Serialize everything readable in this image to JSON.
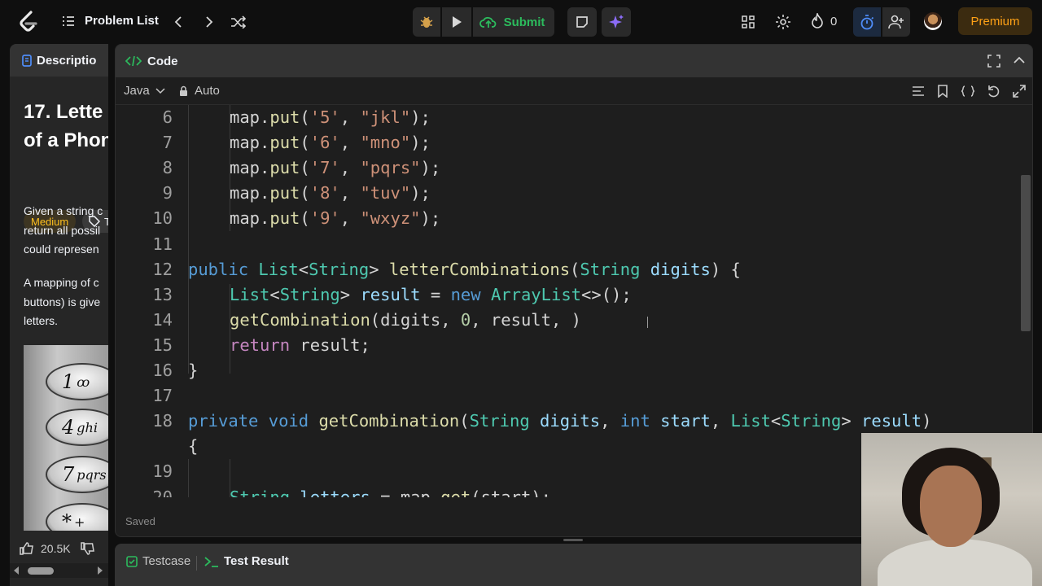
{
  "nav": {
    "problem_list_label": "Problem List",
    "submit_label": "Submit",
    "fire_count": "0",
    "premium_label": "Premium"
  },
  "left": {
    "description_tab": "Descriptio",
    "title_line1": "17. Lette",
    "title_line2": "of a Phon",
    "difficulty": "Medium",
    "topics_label": "T",
    "para1": [
      "Given a string c",
      "return all possil",
      "could represen"
    ],
    "para2": [
      "A mapping of c",
      "buttons) is give",
      "letters."
    ],
    "phone_keys": [
      {
        "digit": "1",
        "letters": "ꝏ"
      },
      {
        "digit": "4",
        "letters": "ghi"
      },
      {
        "digit": "7",
        "letters": "pqrs"
      },
      {
        "digit": "*",
        "letters": "+"
      }
    ],
    "likes": "20.5K"
  },
  "code_panel": {
    "tab_label": "Code",
    "language": "Java",
    "mode": "Auto",
    "status": "Saved"
  },
  "code_lines": [
    {
      "num": "6",
      "segs": [
        [
          "pl",
          "map."
        ],
        [
          "fn",
          "put"
        ],
        [
          "pl",
          "("
        ],
        [
          "st",
          "'5'"
        ],
        [
          "pl",
          ", "
        ],
        [
          "st",
          "\"jkl\""
        ],
        [
          "pl",
          ");"
        ]
      ]
    },
    {
      "num": "7",
      "segs": [
        [
          "pl",
          "map."
        ],
        [
          "fn",
          "put"
        ],
        [
          "pl",
          "("
        ],
        [
          "st",
          "'6'"
        ],
        [
          "pl",
          ", "
        ],
        [
          "st",
          "\"mno\""
        ],
        [
          "pl",
          ");"
        ]
      ]
    },
    {
      "num": "8",
      "segs": [
        [
          "pl",
          "map."
        ],
        [
          "fn",
          "put"
        ],
        [
          "pl",
          "("
        ],
        [
          "st",
          "'7'"
        ],
        [
          "pl",
          ", "
        ],
        [
          "st",
          "\"pqrs\""
        ],
        [
          "pl",
          ");"
        ]
      ]
    },
    {
      "num": "9",
      "segs": [
        [
          "pl",
          "map."
        ],
        [
          "fn",
          "put"
        ],
        [
          "pl",
          "("
        ],
        [
          "st",
          "'8'"
        ],
        [
          "pl",
          ", "
        ],
        [
          "st",
          "\"tuv\""
        ],
        [
          "pl",
          ");"
        ]
      ]
    },
    {
      "num": "10",
      "segs": [
        [
          "pl",
          "map."
        ],
        [
          "fn",
          "put"
        ],
        [
          "pl",
          "("
        ],
        [
          "st",
          "'9'"
        ],
        [
          "pl",
          ", "
        ],
        [
          "st",
          "\"wxyz\""
        ],
        [
          "pl",
          ");"
        ]
      ]
    },
    {
      "num": "11",
      "segs": []
    },
    {
      "num": "12",
      "segs": [
        [
          "kw",
          "public "
        ],
        [
          "ty",
          "List"
        ],
        [
          "pl",
          "<"
        ],
        [
          "ty",
          "String"
        ],
        [
          "pl",
          "> "
        ],
        [
          "fn",
          "letterCombinations"
        ],
        [
          "pl",
          "("
        ],
        [
          "ty",
          "String "
        ],
        [
          "va",
          "digits"
        ],
        [
          "pl",
          ") {"
        ]
      ]
    },
    {
      "num": "13",
      "segs": [
        [
          "ty",
          "List"
        ],
        [
          "pl",
          "<"
        ],
        [
          "ty",
          "String"
        ],
        [
          "pl",
          "> "
        ],
        [
          "va",
          "result"
        ],
        [
          "pl",
          " = "
        ],
        [
          "kw",
          "new "
        ],
        [
          "ty",
          "ArrayList"
        ],
        [
          "pl",
          "<>();"
        ]
      ]
    },
    {
      "num": "14",
      "segs": [
        [
          "fn",
          "getCombination"
        ],
        [
          "pl",
          "(digits, "
        ],
        [
          "nu",
          "0"
        ],
        [
          "pl",
          ", result, )"
        ]
      ]
    },
    {
      "num": "15",
      "segs": [
        [
          "kw2",
          "return "
        ],
        [
          "pl",
          "result;"
        ]
      ]
    },
    {
      "num": "16",
      "segs": [
        [
          "pl",
          "}"
        ]
      ]
    },
    {
      "num": "17",
      "segs": []
    },
    {
      "num": "18",
      "segs": [
        [
          "kw",
          "private "
        ],
        [
          "kw",
          "void "
        ],
        [
          "fn",
          "getCombination"
        ],
        [
          "pl",
          "("
        ],
        [
          "ty",
          "String "
        ],
        [
          "va",
          "digits"
        ],
        [
          "pl",
          ", "
        ],
        [
          "kw",
          "int "
        ],
        [
          "va",
          "start"
        ],
        [
          "pl",
          ", "
        ],
        [
          "ty",
          "List"
        ],
        [
          "pl",
          "<"
        ],
        [
          "ty",
          "String"
        ],
        [
          "pl",
          "> "
        ],
        [
          "va",
          "result"
        ],
        [
          "pl",
          ")"
        ]
      ]
    },
    {
      "num": "",
      "segs": [
        [
          "pl",
          "{"
        ]
      ]
    },
    {
      "num": "19",
      "segs": []
    },
    {
      "num": "20",
      "segs": [
        [
          "ty",
          "String "
        ],
        [
          "va",
          "letters"
        ],
        [
          "pl",
          " = map."
        ],
        [
          "fn",
          "get"
        ],
        [
          "pl",
          "(start);"
        ]
      ]
    }
  ],
  "bottom": {
    "testcase_label": "Testcase",
    "test_result_label": "Test Result"
  },
  "colors": {
    "accent": "#ffa116",
    "submit_green": "#2cbb5d",
    "medium": "#ffc01e",
    "timer_blue": "#4f8df9"
  }
}
